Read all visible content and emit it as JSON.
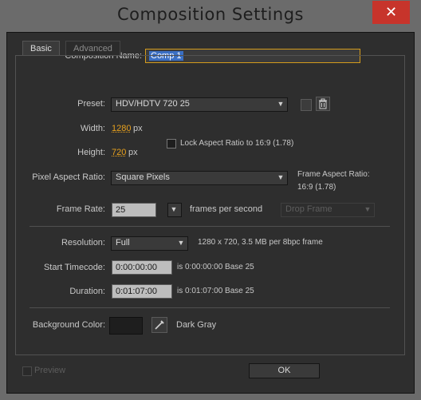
{
  "window": {
    "title": "Composition Settings",
    "close_glyph": "✕"
  },
  "composition_name": {
    "label": "Composition Name:",
    "value": "Comp 1"
  },
  "tabs": [
    {
      "label": "Basic",
      "active": true
    },
    {
      "label": "Advanced",
      "active": false
    }
  ],
  "preset": {
    "label": "Preset:",
    "value": "HDV/HDTV 720 25"
  },
  "width": {
    "label": "Width:",
    "value": "1280",
    "unit": "px"
  },
  "height": {
    "label": "Height:",
    "value": "720",
    "unit": "px"
  },
  "lock_aspect": {
    "label": "Lock Aspect Ratio to 16:9 (1.78)",
    "checked": false
  },
  "pixel_aspect": {
    "label": "Pixel Aspect Ratio:",
    "value": "Square Pixels"
  },
  "frame_aspect": {
    "label": "Frame Aspect Ratio:",
    "value": "16:9 (1.78)"
  },
  "frame_rate": {
    "label": "Frame Rate:",
    "value": "25",
    "unit": "frames per second",
    "drop_frame": "Drop Frame"
  },
  "resolution": {
    "label": "Resolution:",
    "value": "Full",
    "info": "1280 x 720, 3.5 MB per 8bpc frame"
  },
  "start_timecode": {
    "label": "Start Timecode:",
    "value": "0:00:00:00",
    "info": "is 0:00:00:00  Base 25"
  },
  "duration": {
    "label": "Duration:",
    "value": "0:01:07:00",
    "info": "is 0:01:07:00  Base 25"
  },
  "background": {
    "label": "Background Color:",
    "color": "#1e1e1e",
    "name": "Dark Gray"
  },
  "footer": {
    "preview_label": "Preview",
    "ok_label": "OK"
  },
  "icons": {
    "close": "close-icon",
    "trash": "trash-icon",
    "eyedropper": "eyedropper-icon"
  }
}
